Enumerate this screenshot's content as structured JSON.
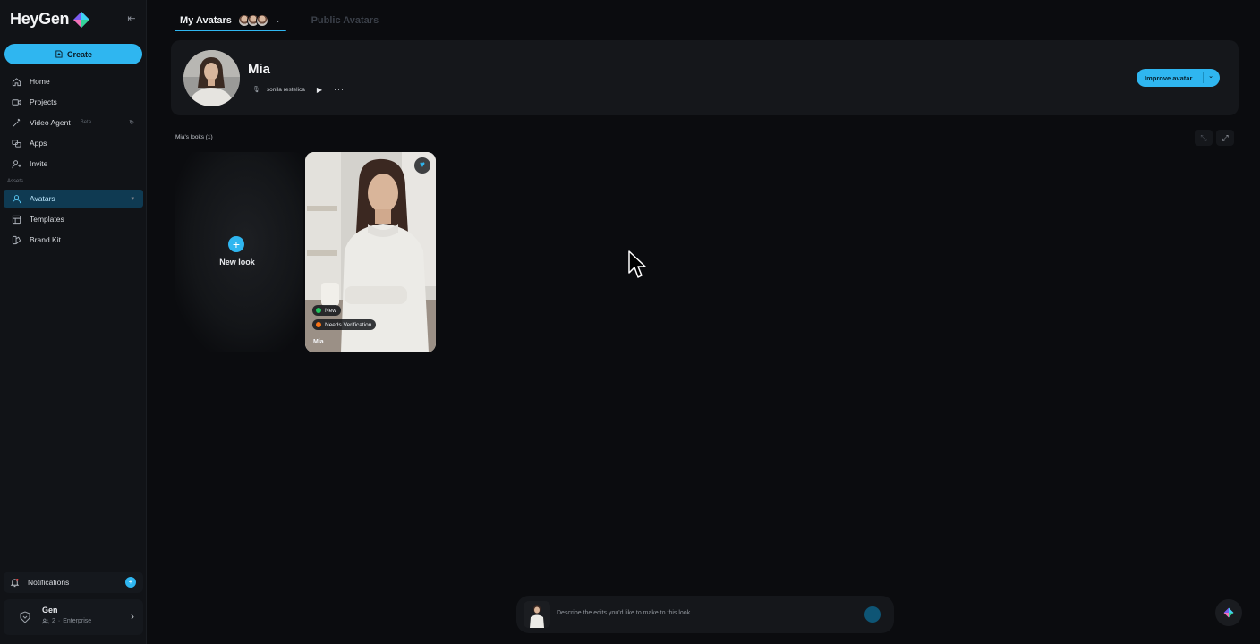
{
  "sidebar": {
    "logo_text": "HeyGen",
    "create_label": "Create",
    "items": [
      {
        "label": "Home"
      },
      {
        "label": "Projects"
      },
      {
        "label": "Video Agent",
        "tag": "Beta"
      },
      {
        "label": "Apps"
      },
      {
        "label": "Invite"
      }
    ],
    "section_label": "Assets",
    "assets": [
      {
        "label": "Avatars"
      },
      {
        "label": "Templates"
      },
      {
        "label": "Brand Kit"
      }
    ],
    "notifications_label": "Notifications",
    "notifications_count": "+",
    "account": {
      "name": "Gen",
      "members": "2",
      "plan": "Enterprise"
    }
  },
  "tabs": [
    {
      "label": "My Avatars"
    },
    {
      "label": "Public Avatars"
    }
  ],
  "avatar": {
    "name": "Mia",
    "voice": "sonila restelica",
    "improve_label": "Improve avatar"
  },
  "looks": {
    "section_label": "Mia's looks (1)",
    "new_look_label": "New look",
    "cards": [
      {
        "name": "Mia",
        "badges": [
          "New",
          "Needs Verification"
        ]
      }
    ]
  },
  "prompt": {
    "placeholder": "Describe the edits you'd like to make to this look"
  },
  "colors": {
    "accent": "#2fb6f0",
    "badge_new": "#22c55e",
    "badge_warning": "#f97316"
  }
}
